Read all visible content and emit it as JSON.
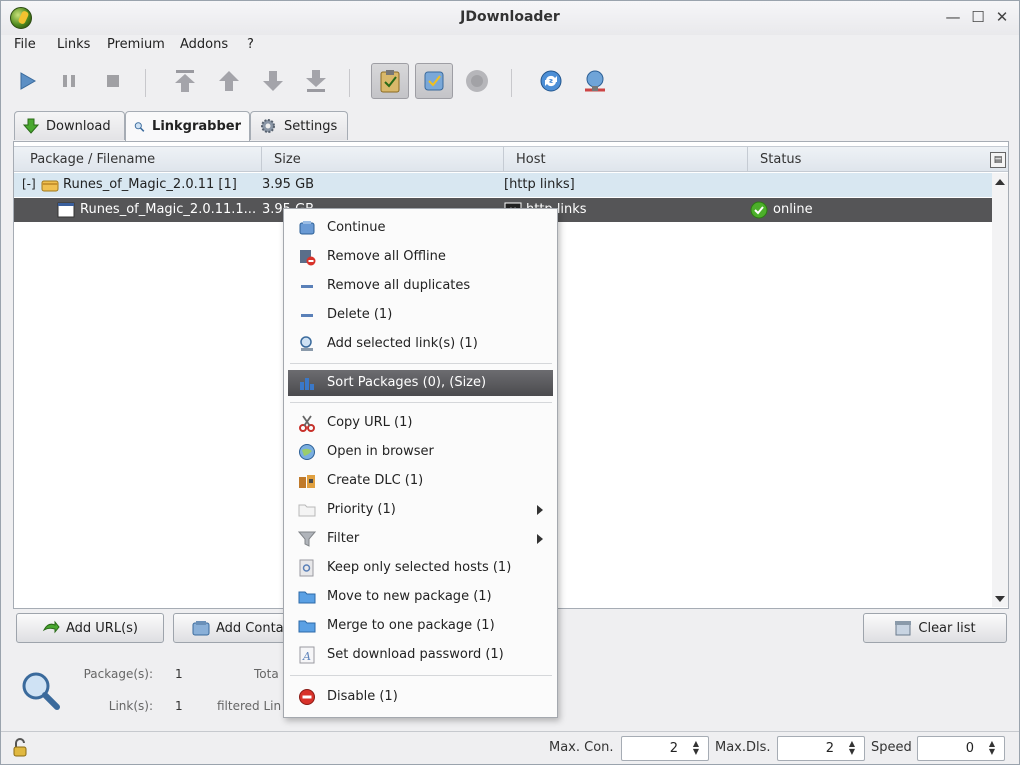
{
  "window": {
    "title": "JDownloader",
    "controls": {
      "minimize": "—",
      "maximize": "☐",
      "close": "✕"
    }
  },
  "menubar": [
    "File",
    "Links",
    "Premium",
    "Addons",
    "?"
  ],
  "toolbar": {
    "icons": [
      "play-icon",
      "pause-icon",
      "stop-icon",
      "move-top-icon",
      "move-up-icon",
      "move-down-icon",
      "move-bottom-icon",
      "clipboard-icon",
      "reconnect-icon",
      "premium-icon",
      "refresh-icon",
      "update-icon"
    ]
  },
  "tabs": [
    {
      "label": "Download"
    },
    {
      "label": "Linkgrabber"
    },
    {
      "label": "Settings"
    }
  ],
  "table": {
    "columns": [
      "Package / Filename",
      "Size",
      "Host",
      "Status"
    ],
    "package": {
      "expander": "[-]",
      "name": "Runes_of_Magic_2.0.11 [1]",
      "size": "3.95 GB",
      "host": "[http links]"
    },
    "file": {
      "name": "Runes_of_Magic_2.0.11.1...",
      "size": "3.95 GB",
      "host": "http links",
      "status": "online"
    }
  },
  "context_menu": {
    "items": [
      {
        "label": "Continue",
        "icon": "continue-icon"
      },
      {
        "label": "Remove all Offline",
        "icon": "remove-offline-icon"
      },
      {
        "label": "Remove all duplicates",
        "icon": "minus-icon"
      },
      {
        "label": "Delete (1)",
        "icon": "minus-icon"
      },
      {
        "label": "Add selected link(s) (1)",
        "icon": "add-link-icon"
      },
      {
        "label": "Sort Packages (0), (Size)",
        "icon": "sort-icon"
      },
      {
        "label": "Copy URL (1)",
        "icon": "scissors-icon"
      },
      {
        "label": "Open in browser",
        "icon": "globe-icon"
      },
      {
        "label": "Create DLC (1)",
        "icon": "dlc-icon"
      },
      {
        "label": "Priority (1)",
        "icon": "folder-icon"
      },
      {
        "label": "Filter",
        "icon": "filter-icon"
      },
      {
        "label": "Keep only selected hosts (1)",
        "icon": "host-icon"
      },
      {
        "label": "Move to new package (1)",
        "icon": "folder-icon"
      },
      {
        "label": "Merge to one package (1)",
        "icon": "folder-icon"
      },
      {
        "label": "Set download password (1)",
        "icon": "password-icon"
      },
      {
        "label": "Disable (1)",
        "icon": "disable-icon"
      }
    ]
  },
  "buttons": {
    "add_urls": "Add URL(s)",
    "add_container": "Add Conta",
    "clear_list": "Clear list"
  },
  "info": {
    "packages_label": "Package(s):",
    "packages_value": "1",
    "links_label": "Link(s):",
    "links_value": "1",
    "total_label": "Tota",
    "filtered_label": "filtered Lin"
  },
  "statusbar": {
    "max_con_label": "Max. Con.",
    "max_con_value": "2",
    "max_dls_label": "Max.Dls.",
    "max_dls_value": "2",
    "speed_label": "Speed",
    "speed_value": "0"
  },
  "colors": {
    "selection": "#555557",
    "package_row": "#d8e7f1",
    "online": "#4caf2a",
    "header": "#dfe5ec"
  }
}
